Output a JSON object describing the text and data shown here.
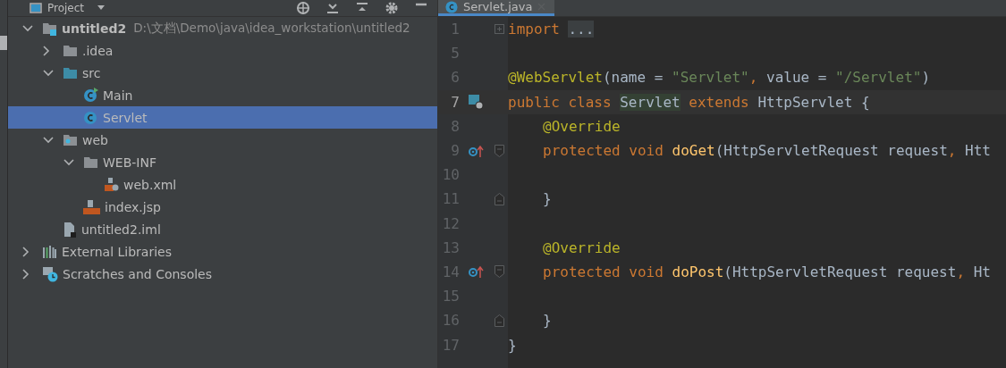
{
  "project_panel": {
    "title": "Project",
    "tree": [
      {
        "name": "untitled2",
        "path": "D:\\文档\\Demo\\java\\idea_workstation\\untitled2",
        "kind": "module",
        "expanded": true,
        "selected": false,
        "children": [
          {
            "name": ".idea",
            "kind": "folder",
            "expanded": false,
            "selected": false
          },
          {
            "name": "src",
            "kind": "source-folder",
            "expanded": true,
            "selected": false,
            "children": [
              {
                "name": "Main",
                "kind": "main-class",
                "selected": false
              },
              {
                "name": "Servlet",
                "kind": "class",
                "selected": true
              }
            ]
          },
          {
            "name": "web",
            "kind": "web-folder",
            "expanded": true,
            "selected": false,
            "children": [
              {
                "name": "WEB-INF",
                "kind": "folder",
                "expanded": true,
                "selected": false,
                "children": [
                  {
                    "name": "web.xml",
                    "kind": "xml",
                    "selected": false
                  }
                ]
              },
              {
                "name": "index.jsp",
                "kind": "jsp",
                "selected": false
              }
            ]
          },
          {
            "name": "untitled2.iml",
            "kind": "iml",
            "selected": false
          }
        ]
      },
      {
        "name": "External Libraries",
        "kind": "libraries",
        "expanded": false,
        "selected": false
      },
      {
        "name": "Scratches and Consoles",
        "kind": "scratches",
        "expanded": false,
        "selected": false
      }
    ]
  },
  "editor": {
    "tabs": [
      {
        "label": "Servlet.java",
        "selected": true
      }
    ],
    "lines": [
      {
        "number": "1",
        "current": false,
        "indented": false,
        "fold": {
          "kind": "collapsed"
        },
        "tokens": [
          {
            "kind": "keyword",
            "text": "import "
          },
          {
            "kind": "folded",
            "text": "..."
          }
        ]
      },
      {
        "number": "5",
        "current": false
      },
      {
        "number": "6",
        "current": false,
        "indented": false,
        "tokens": [
          {
            "kind": "annotation",
            "text": "@WebServlet"
          },
          {
            "kind": "plain",
            "text": "(name = "
          },
          {
            "kind": "string",
            "text": "\"Servlet\""
          },
          {
            "kind": "keyword",
            "text": ", "
          },
          {
            "kind": "plain",
            "text": "value = "
          },
          {
            "kind": "string",
            "text": "\"/Servlet\""
          },
          {
            "kind": "plain",
            "text": ")"
          }
        ]
      },
      {
        "number": "7",
        "current": true,
        "indented": false,
        "gutter": {
          "kind": "servlet"
        },
        "tokens": [
          {
            "kind": "keyword",
            "text": "public class "
          },
          {
            "kind": "usage",
            "text": "Servlet"
          },
          {
            "kind": "keyword",
            "text": " extends "
          },
          {
            "kind": "plain",
            "text": "HttpServlet {"
          }
        ]
      },
      {
        "number": "8",
        "current": false,
        "indented": true,
        "tokens": [
          {
            "kind": "annotation",
            "text": "@Override"
          }
        ]
      },
      {
        "number": "9",
        "current": false,
        "indented": true,
        "gutter": {
          "kind": "override"
        },
        "fold": {
          "kind": "start"
        },
        "tokens": [
          {
            "kind": "keyword",
            "text": "protected void "
          },
          {
            "kind": "method",
            "text": "doGet"
          },
          {
            "kind": "plain",
            "text": "(HttpServletRequest request"
          },
          {
            "kind": "keyword",
            "text": ", "
          },
          {
            "kind": "plain",
            "text": "Htt"
          }
        ]
      },
      {
        "number": "10",
        "current": false
      },
      {
        "number": "11",
        "current": false,
        "indented": true,
        "fold": {
          "kind": "end"
        },
        "tokens": [
          {
            "kind": "plain",
            "text": "}"
          }
        ]
      },
      {
        "number": "12",
        "current": false
      },
      {
        "number": "13",
        "current": false,
        "indented": true,
        "tokens": [
          {
            "kind": "annotation",
            "text": "@Override"
          }
        ]
      },
      {
        "number": "14",
        "current": false,
        "indented": true,
        "gutter": {
          "kind": "override"
        },
        "fold": {
          "kind": "start"
        },
        "tokens": [
          {
            "kind": "keyword",
            "text": "protected void "
          },
          {
            "kind": "method",
            "text": "doPost"
          },
          {
            "kind": "plain",
            "text": "(HttpServletRequest request"
          },
          {
            "kind": "keyword",
            "text": ", "
          },
          {
            "kind": "plain",
            "text": "Ht"
          }
        ]
      },
      {
        "number": "15",
        "current": false
      },
      {
        "number": "16",
        "current": false,
        "indented": true,
        "fold": {
          "kind": "end"
        },
        "tokens": [
          {
            "kind": "plain",
            "text": "}"
          }
        ]
      },
      {
        "number": "17",
        "current": false,
        "indented": false,
        "tokens": [
          {
            "kind": "plain",
            "text": "}"
          }
        ]
      }
    ]
  }
}
